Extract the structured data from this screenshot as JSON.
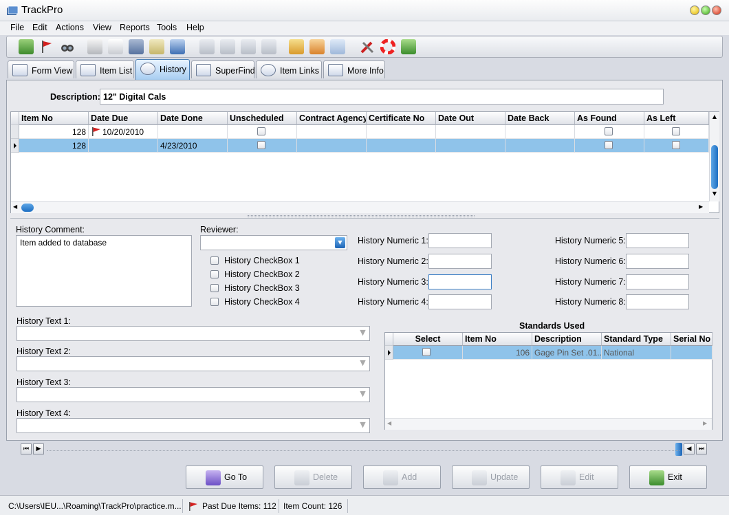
{
  "window": {
    "title": "TrackPro"
  },
  "menu": [
    "File",
    "Edit",
    "Actions",
    "View",
    "Reports",
    "Tools",
    "Help"
  ],
  "tabs": [
    {
      "label": "Form View",
      "icon": "form-view-icon"
    },
    {
      "label": "Item List",
      "icon": "item-list-icon"
    },
    {
      "label": "History",
      "icon": "history-gauge-icon"
    },
    {
      "label": "SuperFind",
      "icon": "superfind-icon"
    },
    {
      "label": "Item Links",
      "icon": "item-links-icon"
    },
    {
      "label": "More Info",
      "icon": "more-info-icon"
    }
  ],
  "active_tab": "History",
  "description": {
    "label": "Description:",
    "value": "12\" Digital Cals"
  },
  "history_grid": {
    "columns": [
      "Item No",
      "Date Due",
      "Date Done",
      "Unscheduled",
      "Contract Agency",
      "Certificate No",
      "Date Out",
      "Date Back",
      "As Found",
      "As Left"
    ],
    "rows": [
      {
        "item_no": "128",
        "date_due": "10/20/2010",
        "date_done": "",
        "flag": true,
        "selected": false
      },
      {
        "item_no": "128",
        "date_due": "",
        "date_done": "4/23/2010",
        "flag": false,
        "selected": true
      }
    ]
  },
  "form": {
    "history_comment_label": "History Comment:",
    "history_comment_value": "Item added to database",
    "reviewer_label": "Reviewer:",
    "reviewer_value": "",
    "checkboxes": [
      "History CheckBox 1",
      "History CheckBox 2",
      "History CheckBox 3",
      "History CheckBox 4"
    ],
    "numerics_left": [
      "History Numeric 1:",
      "History Numeric 2:",
      "History Numeric 3:",
      "History Numeric 4:"
    ],
    "numerics_right": [
      "History Numeric 5:",
      "History Numeric 6:",
      "History Numeric 7:",
      "History Numeric 8:"
    ],
    "texts": [
      "History Text 1:",
      "History Text 2:",
      "History Text 3:",
      "History Text 4:"
    ]
  },
  "standards": {
    "title": "Standards Used",
    "columns": [
      "Select",
      "Item No",
      "Description",
      "Standard Type",
      "Serial No"
    ],
    "rows": [
      {
        "item_no": "106",
        "description": "Gage Pin Set .01...",
        "standard_type": "National",
        "serial_no": ""
      }
    ]
  },
  "actions": [
    {
      "label": "Go To",
      "enabled": true
    },
    {
      "label": "Delete",
      "enabled": false
    },
    {
      "label": "Add",
      "enabled": false
    },
    {
      "label": "Update",
      "enabled": false
    },
    {
      "label": "Edit",
      "enabled": false
    },
    {
      "label": "Exit",
      "enabled": true
    }
  ],
  "status": {
    "path": "C:\\Users\\IEU...\\Roaming\\TrackPro\\practice.m...",
    "past_due": "Past Due Items: 112",
    "item_count": "Item Count: 126"
  },
  "colors": {
    "selection": "#8fc3ea",
    "accent": "#3c7fc5",
    "flag": "#d42020"
  }
}
